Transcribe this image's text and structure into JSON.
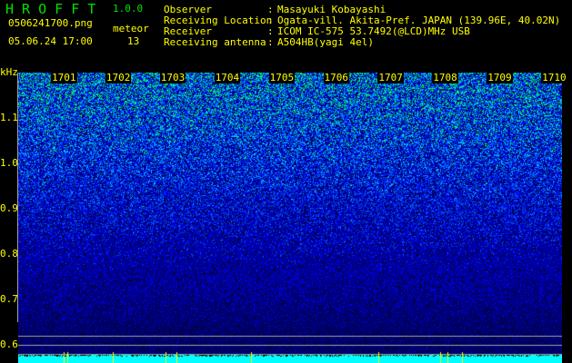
{
  "app": {
    "name": "H R O F F T",
    "version": "1.0.0"
  },
  "file": {
    "name": "0506241700.png",
    "datetime": "05.06.24 17:00"
  },
  "meteor": {
    "label": "meteor",
    "count": "13"
  },
  "info": [
    {
      "label": "Observer",
      "value": "Masayuki Kobayashi"
    },
    {
      "label": "Receiving Location",
      "value": "Ogata-vill. Akita-Pref. JAPAN (139.96E, 40.02N)"
    },
    {
      "label": "Receiver",
      "value": "ICOM IC-575 53.7492(@LCD)MHz USB"
    },
    {
      "label": "Receiving antenna",
      "value": "A504HB(yagi 4el)"
    }
  ],
  "spectrogram": {
    "y_unit": "kHz",
    "y_ticks": [
      "1.1",
      "1.0",
      "0.9",
      "0.8",
      "0.7",
      "0.6"
    ],
    "time_ticks": [
      "1701",
      "1702",
      "1703",
      "1704",
      "1705",
      "1706",
      "1707",
      "1708",
      "1709",
      "1710"
    ],
    "colors": {
      "text": "#ffff00",
      "title": "#00e000",
      "bottom_band": "#00ffff",
      "grid_line": "#a0a0a0"
    }
  }
}
